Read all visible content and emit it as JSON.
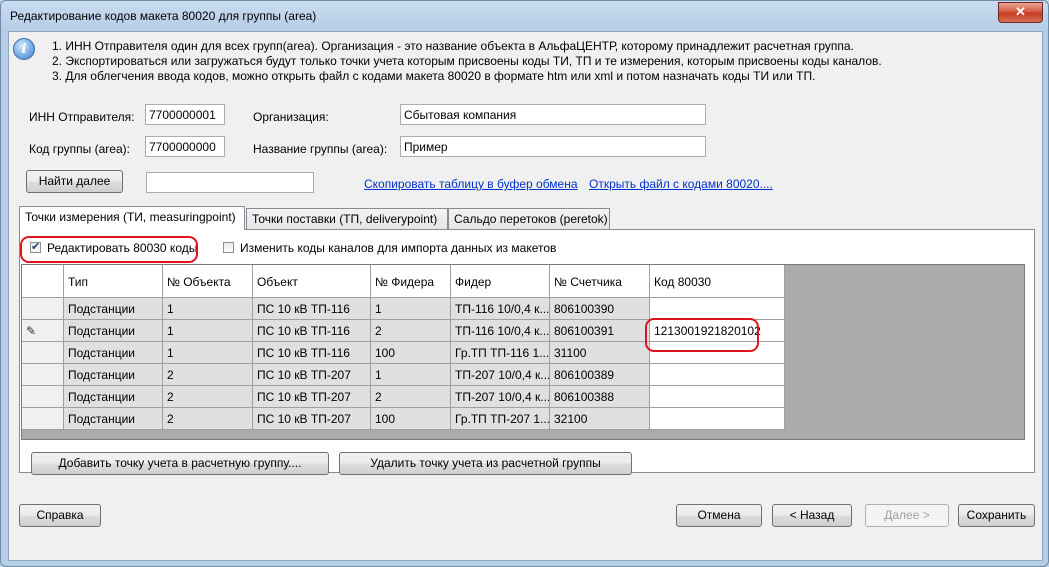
{
  "window": {
    "title": "Редактирование кодов макета 80020 для группы (area)",
    "close_glyph": "✕"
  },
  "info": {
    "icon": "info-icon",
    "line1": "1. ИНН Отправителя один для всех групп(area). Организация - это название объекта в АльфаЦЕНТР, которому принадлежит расчетная группа.",
    "line2": "2. Экспортироваться или загружаться будут только точки учета которым присвоены коды ТИ, ТП и те измерения, которым присвоены коды каналов.",
    "line3": "3. Для облегчения ввода кодов, можно открыть файл с кодами макета 80020 в формате htm или xml и потом назначать коды ТИ или ТП."
  },
  "form": {
    "inn_label": "ИНН Отправителя:",
    "inn_value": "7700000001",
    "org_label": "Организация:",
    "org_value": "Сбытовая компания",
    "group_code_label": "Код группы (area):",
    "group_code_value": "7700000000",
    "group_name_label": "Название группы (area):",
    "group_name_value": "Пример",
    "find_next_button": "Найти далее",
    "search_value": "",
    "copy_link": "Скопировать таблицу в буфер обмена",
    "open_link": "Открыть файл с кодами 80020...."
  },
  "tabs": [
    {
      "label": "Точки измерения (ТИ, measuringpoint)",
      "active": true
    },
    {
      "label": "Точки поставки (ТП, deliverypoint)",
      "active": false
    },
    {
      "label": "Сальдо перетоков (peretok)",
      "active": false
    }
  ],
  "options": {
    "edit_80030_label": "Редактировать 80030 коды",
    "edit_80030_checked": true,
    "change_channels_label": "Изменить коды каналов для импорта данных из макетов",
    "change_channels_checked": false
  },
  "table": {
    "columns": [
      "Тип",
      "№ Объекта",
      "Объект",
      "№ Фидера",
      "Фидер",
      "№ Счетчика",
      "Код 80030"
    ],
    "current_row_indicator": "✎",
    "rows": [
      [
        "Подстанции",
        "1",
        "ПС 10 кВ ТП-116",
        "1",
        "ТП-116 10/0,4 к...",
        "806100390",
        ""
      ],
      [
        "Подстанции",
        "1",
        "ПС 10 кВ ТП-116",
        "2",
        "ТП-116 10/0,4 к...",
        "806100391",
        "1213001921820102"
      ],
      [
        "Подстанции",
        "1",
        "ПС 10 кВ ТП-116",
        "100",
        "Гр.ТП ТП-116 1...",
        "31100",
        ""
      ],
      [
        "Подстанции",
        "2",
        "ПС 10 кВ ТП-207",
        "1",
        "ТП-207 10/0,4 к...",
        "806100389",
        ""
      ],
      [
        "Подстанции",
        "2",
        "ПС 10 кВ ТП-207",
        "2",
        "ТП-207 10/0,4 к...",
        "806100388",
        ""
      ],
      [
        "Подстанции",
        "2",
        "ПС 10 кВ ТП-207",
        "100",
        "Гр.ТП ТП-207 1...",
        "32100",
        ""
      ]
    ]
  },
  "actions": {
    "add_point_button": "Добавить точку учета в расчетную группу....",
    "remove_point_button": "Удалить точку учета из расчетной группы"
  },
  "footer": {
    "help_button": "Справка",
    "cancel_button": "Отмена",
    "back_button": "< Назад",
    "next_button": "Далее >",
    "save_button": "Сохранить"
  },
  "colors": {
    "highlight_red": "#e0151b",
    "link_blue": "#0033cc"
  }
}
